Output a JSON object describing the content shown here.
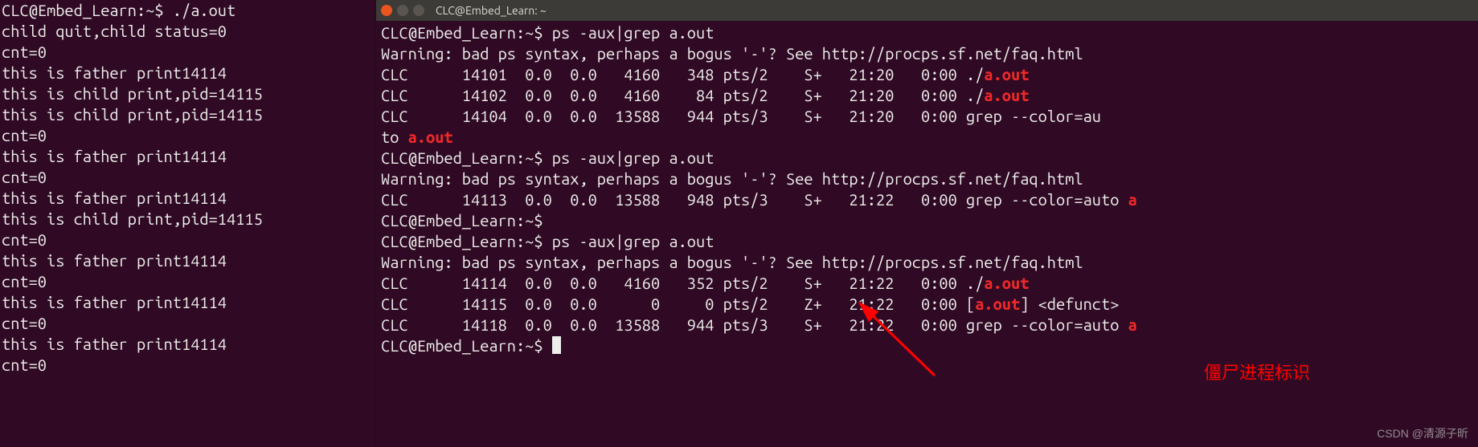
{
  "left_terminal": {
    "lines": [
      {
        "parts": [
          {
            "t": "CLC@Embed_Learn:~$ ./a.out"
          }
        ]
      },
      {
        "parts": [
          {
            "t": "child quit,child status=0"
          }
        ]
      },
      {
        "parts": [
          {
            "t": "cnt=0"
          }
        ]
      },
      {
        "parts": [
          {
            "t": "this is father print14114"
          }
        ]
      },
      {
        "parts": [
          {
            "t": "this is child print,pid=14115"
          }
        ]
      },
      {
        "parts": [
          {
            "t": "this is child print,pid=14115"
          }
        ]
      },
      {
        "parts": [
          {
            "t": "cnt=0"
          }
        ]
      },
      {
        "parts": [
          {
            "t": "this is father print14114"
          }
        ]
      },
      {
        "parts": [
          {
            "t": "cnt=0"
          }
        ]
      },
      {
        "parts": [
          {
            "t": "this is father print14114"
          }
        ]
      },
      {
        "parts": [
          {
            "t": "this is child print,pid=14115"
          }
        ]
      },
      {
        "parts": [
          {
            "t": "cnt=0"
          }
        ]
      },
      {
        "parts": [
          {
            "t": "this is father print14114"
          }
        ]
      },
      {
        "parts": [
          {
            "t": "cnt=0"
          }
        ]
      },
      {
        "parts": [
          {
            "t": "this is father print14114"
          }
        ]
      },
      {
        "parts": [
          {
            "t": "cnt=0"
          }
        ]
      },
      {
        "parts": [
          {
            "t": "this is father print14114"
          }
        ]
      },
      {
        "parts": [
          {
            "t": "cnt=0"
          }
        ]
      }
    ]
  },
  "right_terminal": {
    "title": "CLC@Embed_Learn: ~",
    "lines": [
      {
        "parts": [
          {
            "t": "CLC@Embed_Learn:~$ ps -aux|grep a.out"
          }
        ]
      },
      {
        "parts": [
          {
            "t": "Warning: bad ps syntax, perhaps a bogus '-'? See http://procps.sf.net/faq.html"
          }
        ]
      },
      {
        "parts": [
          {
            "t": "CLC      14101  0.0  0.0   4160   348 pts/2    S+   21:20   0:00 ./"
          },
          {
            "t": "a.out",
            "hl": true
          }
        ]
      },
      {
        "parts": [
          {
            "t": "CLC      14102  0.0  0.0   4160    84 pts/2    S+   21:20   0:00 ./"
          },
          {
            "t": "a.out",
            "hl": true
          }
        ]
      },
      {
        "parts": [
          {
            "t": "CLC      14104  0.0  0.0  13588   944 pts/3    S+   21:20   0:00 grep --color=au"
          }
        ]
      },
      {
        "parts": [
          {
            "t": "to "
          },
          {
            "t": "a.out",
            "hl": true
          }
        ]
      },
      {
        "parts": [
          {
            "t": "CLC@Embed_Learn:~$ ps -aux|grep a.out"
          }
        ]
      },
      {
        "parts": [
          {
            "t": "Warning: bad ps syntax, perhaps a bogus '-'? See http://procps.sf.net/faq.html"
          }
        ]
      },
      {
        "parts": [
          {
            "t": "CLC      14113  0.0  0.0  13588   948 pts/3    S+   21:22   0:00 grep --color=auto "
          },
          {
            "t": "a",
            "hl": true
          }
        ]
      },
      {
        "parts": [
          {
            "t": "CLC@Embed_Learn:~$ "
          }
        ]
      },
      {
        "parts": [
          {
            "t": "CLC@Embed_Learn:~$ ps -aux|grep a.out"
          }
        ]
      },
      {
        "parts": [
          {
            "t": "Warning: bad ps syntax, perhaps a bogus '-'? See http://procps.sf.net/faq.html"
          }
        ]
      },
      {
        "parts": [
          {
            "t": "CLC      14114  0.0  0.0   4160   352 pts/2    S+   21:22   0:00 ./"
          },
          {
            "t": "a.out",
            "hl": true
          }
        ]
      },
      {
        "parts": [
          {
            "t": "CLC      14115  0.0  0.0      0     0 pts/2    Z+   21:22   0:00 ["
          },
          {
            "t": "a.out",
            "hl": true
          },
          {
            "t": "] <defunct>"
          }
        ]
      },
      {
        "parts": [
          {
            "t": "CLC      14118  0.0  0.0  13588   944 pts/3    S+   21:22   0:00 grep --color=auto "
          },
          {
            "t": "a",
            "hl": true
          }
        ]
      },
      {
        "parts": [
          {
            "t": "CLC@Embed_Learn:~$ "
          }
        ],
        "cursor": true
      }
    ]
  },
  "annotation": "僵尸进程标识",
  "watermark": "CSDN @清源子昕"
}
